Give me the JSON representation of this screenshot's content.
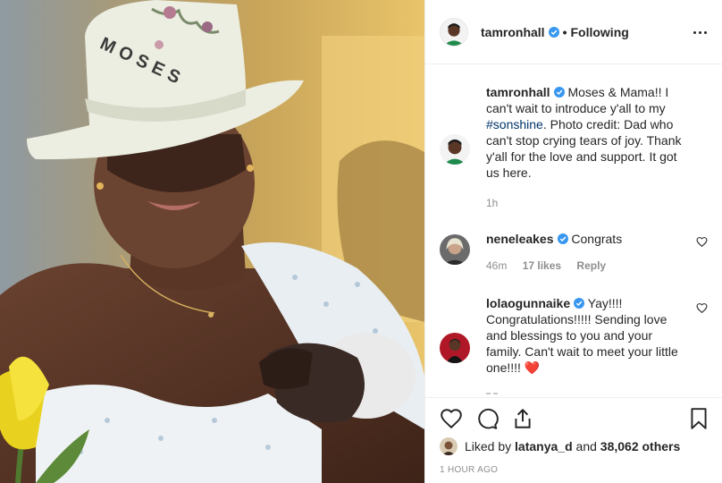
{
  "post": {
    "photo": {
      "hat_text": "MOSES"
    },
    "header": {
      "username": "tamronhall",
      "separator": "•",
      "follow_status": "Following"
    },
    "caption": {
      "username": "tamronhall",
      "text_before_tag": "Moses & Mama!! I can't wait to introduce y'all to my",
      "hashtag": "#sonshine",
      "text_after_tag": ". Photo credit: Dad who can't stop crying tears of joy. Thank y'all for the love and support. It got us here.",
      "age": "1h"
    },
    "comments": [
      {
        "username": "neneleakes",
        "text": "Congrats",
        "age": "46m",
        "likes": "17 likes",
        "reply_label": "Reply"
      },
      {
        "username": "lolaogunnaike",
        "text": "Yay!!!! Congratulations!!!!! Sending love and blessings to you and your family. Can't wait to meet your little one!!!!",
        "emoji": "❤️"
      }
    ],
    "likes": {
      "prefix": "Liked by",
      "liker": "latanya_d",
      "and": "and",
      "others": "38,062 others"
    },
    "timestamp": "1 HOUR AGO",
    "icons": {
      "more": "more-options-icon",
      "like": "heart-icon",
      "comment": "comment-icon",
      "share": "share-icon",
      "save": "bookmark-icon",
      "verified": "verified-badge-icon"
    },
    "colors": {
      "text": "#262626",
      "muted": "#8e8e8e",
      "verified": "#3897f0",
      "hashtag": "#003569",
      "divider": "#efefef",
      "heart_emoji": "#ed1c24"
    }
  }
}
